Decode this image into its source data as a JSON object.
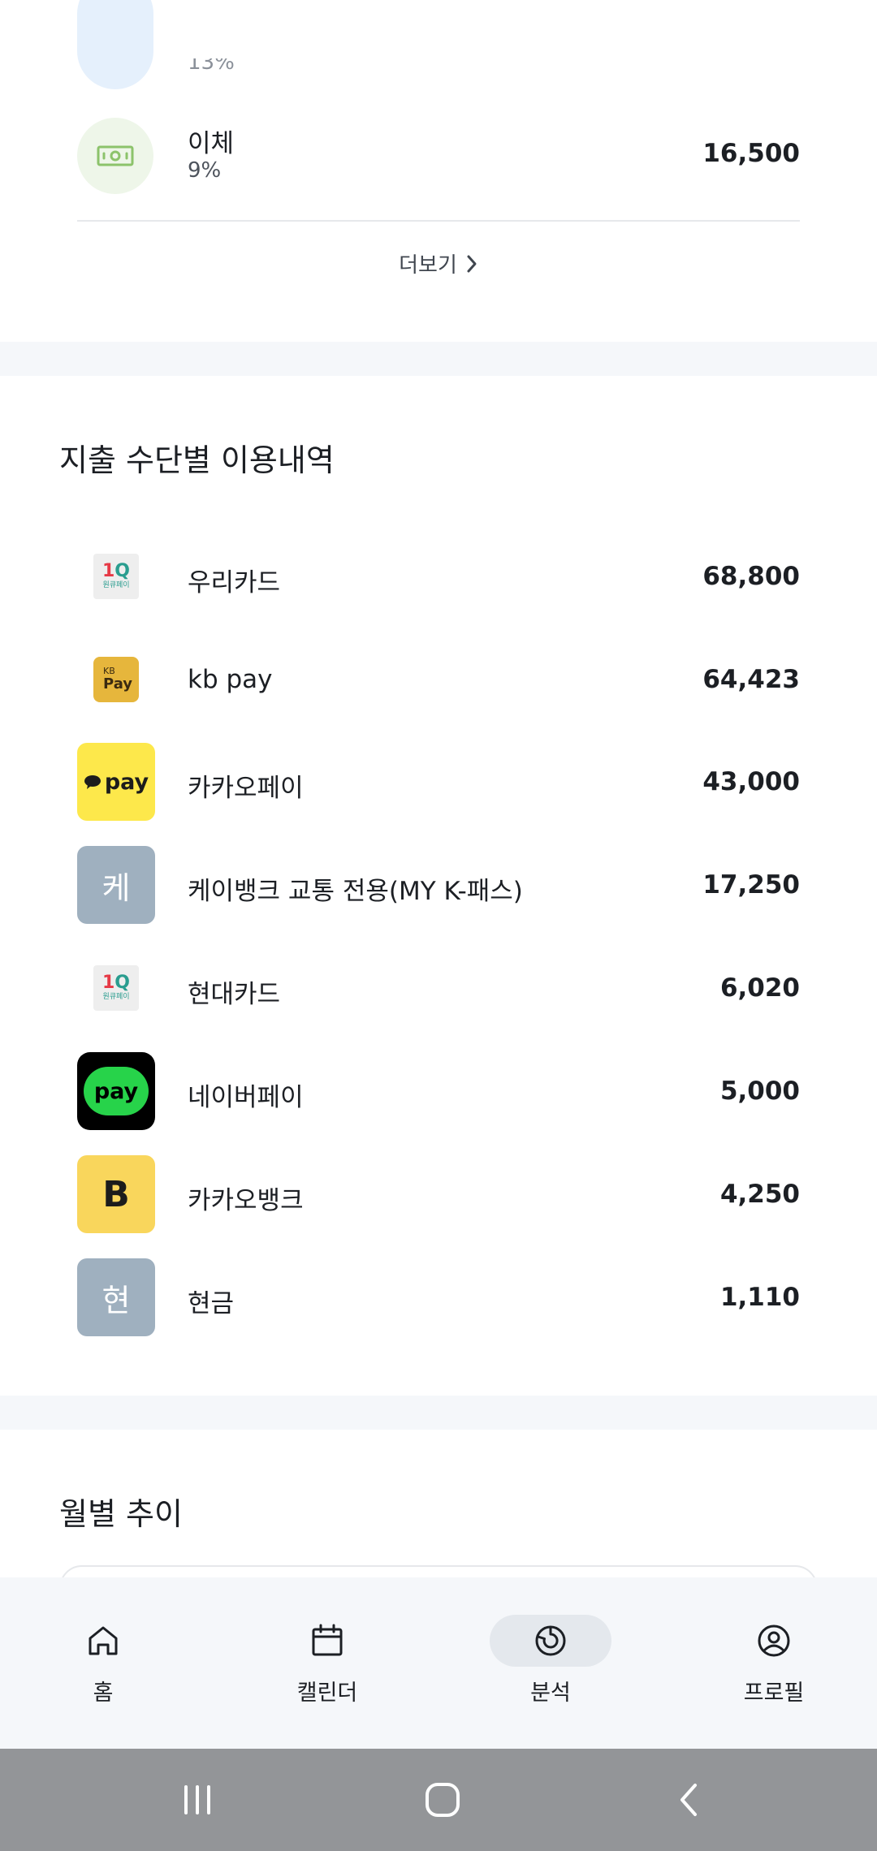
{
  "category_section": {
    "partial_row": {
      "pct": "13%"
    },
    "row": {
      "name": "이체",
      "pct": "9%",
      "amount": "16,500",
      "icon": "banknote-icon"
    },
    "more_label": "더보기"
  },
  "payment_section": {
    "title": "지출 수단별 이용내역",
    "items": [
      {
        "name": "우리카드",
        "amount": "68,800",
        "icon": "woori-card-logo",
        "logo_text": "1Q",
        "logo_sub": "원큐페이"
      },
      {
        "name": "kb pay",
        "amount": "64,423",
        "icon": "kb-pay-logo",
        "logo_text": "Pay",
        "logo_sub": "KB"
      },
      {
        "name": "카카오페이",
        "amount": "43,000",
        "icon": "kakao-pay-logo",
        "logo_text": "pay"
      },
      {
        "name": "케이뱅크 교통 전용(MY K-패스)",
        "amount": "17,250",
        "icon": "initial-badge",
        "logo_text": "케"
      },
      {
        "name": "현대카드",
        "amount": "6,020",
        "icon": "hyundai-card-logo",
        "logo_text": "1Q",
        "logo_sub": "원큐페이"
      },
      {
        "name": "네이버페이",
        "amount": "5,000",
        "icon": "naver-pay-logo",
        "logo_text": "pay"
      },
      {
        "name": "카카오뱅크",
        "amount": "4,250",
        "icon": "kakao-bank-logo",
        "logo_text": "B"
      },
      {
        "name": "현금",
        "amount": "1,110",
        "icon": "initial-badge",
        "logo_text": "현"
      }
    ]
  },
  "monthly_section": {
    "title": "월별 추이"
  },
  "bottom_nav": {
    "items": [
      {
        "label": "홈",
        "icon": "home-icon"
      },
      {
        "label": "캘린더",
        "icon": "calendar-icon"
      },
      {
        "label": "분석",
        "icon": "chart-icon",
        "active": true
      },
      {
        "label": "프로필",
        "icon": "profile-icon"
      }
    ]
  },
  "colors": {
    "background": "#ffffff",
    "band": "#f5f7fa",
    "text": "#1c1f24",
    "subtext": "#4d535c",
    "kakao_yellow": "#fde84b",
    "kb_yellow": "#e6b63c",
    "kakao_bank_yellow": "#f9d65c",
    "naver_green": "#27d34a",
    "initial_badge": "#9fb0bf",
    "system_bar": "#939598"
  }
}
